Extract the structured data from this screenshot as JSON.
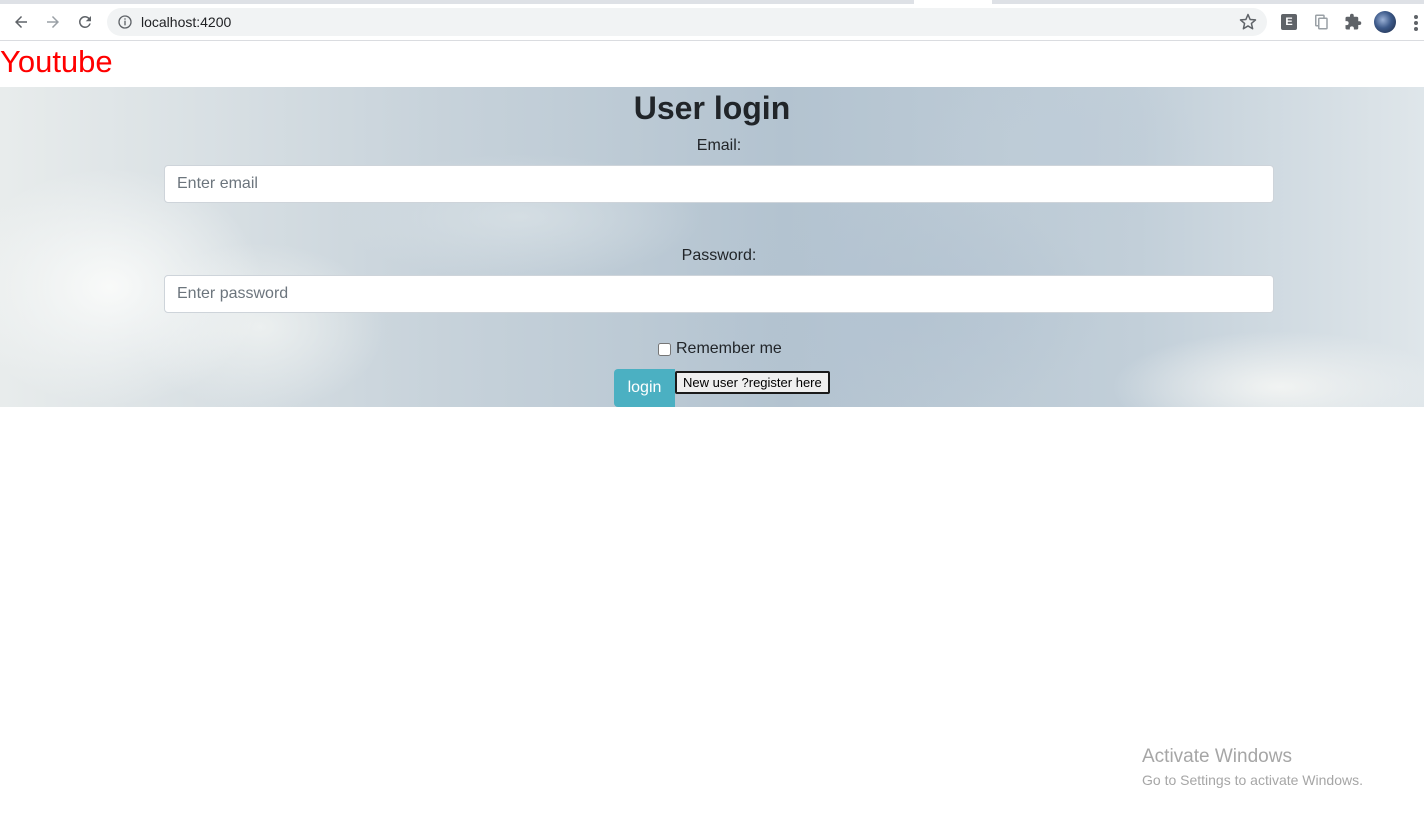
{
  "browser": {
    "url": "localhost:4200",
    "extensions": [
      {
        "name": "e-extension-icon",
        "glyph": "E"
      },
      {
        "name": "clipboard-extension-icon",
        "glyph": ""
      },
      {
        "name": "puzzle-extensions-icon",
        "glyph": ""
      }
    ]
  },
  "header": {
    "brand": "Youtube",
    "brand_color": "#ff0000"
  },
  "login": {
    "title": "User login",
    "email_label": "Email:",
    "email_placeholder": "Enter email",
    "email_value": "",
    "password_label": "Password:",
    "password_placeholder": "Enter password",
    "password_value": "",
    "remember_label": "Remember me",
    "remember_checked": false,
    "login_button": "login",
    "login_button_color": "#4bb0c2",
    "register_button": "New user ?register here"
  },
  "watermark": {
    "title": "Activate Windows",
    "subtitle": "Go to Settings to activate Windows."
  }
}
